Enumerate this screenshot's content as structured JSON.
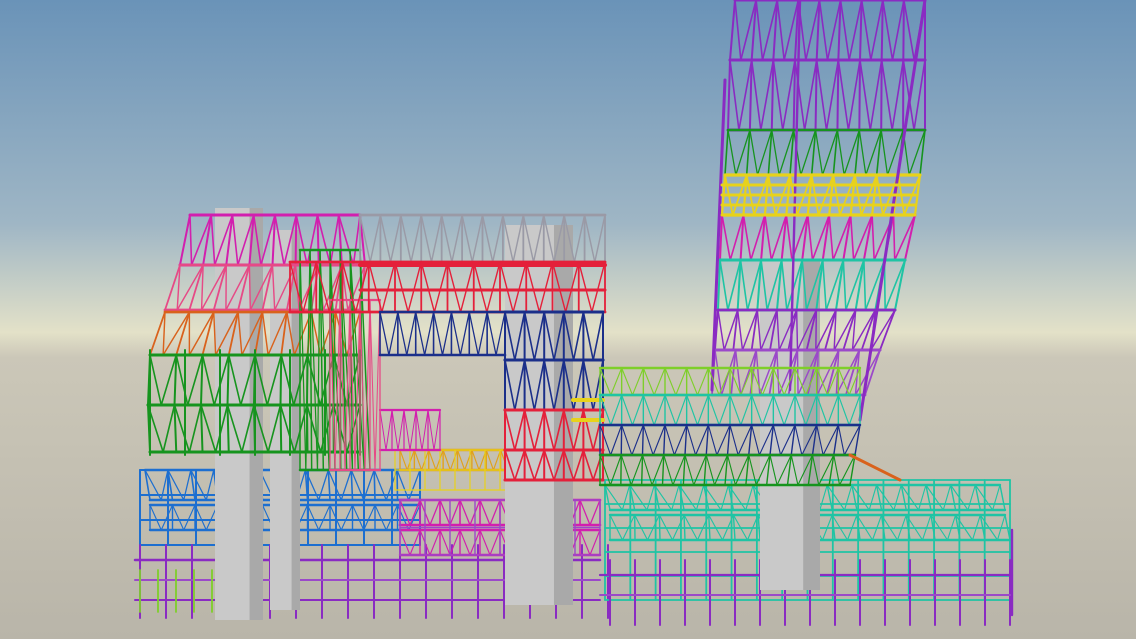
{
  "scene": {
    "subject": "structural-steel-frame-model",
    "colors": {
      "sky_top": "#6a93b8",
      "sky_mid": "#a9bcc6",
      "horizon": "#e3e1c8",
      "ground": "#bdb9ad",
      "concrete": "#c9c9c9",
      "concrete_shade": "#a9a9a9"
    },
    "palette": {
      "magenta": "#d21fae",
      "pink": "#e64a86",
      "red": "#e4203a",
      "green": "#16941e",
      "orange": "#d9621c",
      "navy": "#1b2f8a",
      "blue": "#1d6fd0",
      "purple": "#8a2bc2",
      "violet": "#9b49c9",
      "yellow": "#e8d21a",
      "amber": "#e0a21c",
      "teal": "#1fc4a4",
      "lime": "#7ecf2a",
      "grey": "#9a9aa6"
    }
  }
}
